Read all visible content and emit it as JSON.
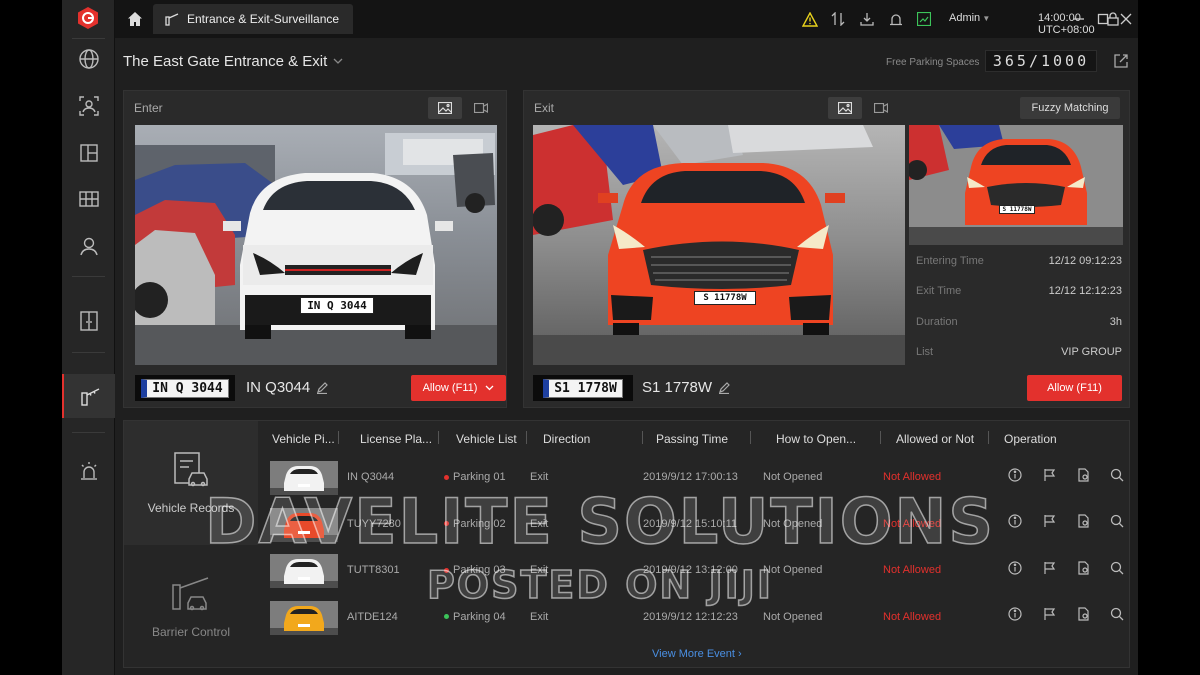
{
  "window": {
    "tab_title": "Entrance & Exit-Surveillance",
    "admin": "Admin",
    "clock": "14:00:00 UTC+08:00"
  },
  "header": {
    "gate_title": "The East Gate Entrance & Exit",
    "free_spaces_label": "Free Parking Spaces",
    "free_spaces_value": "365/1000"
  },
  "enter_panel": {
    "label": "Enter",
    "photo_plate": "IN Q 3044",
    "plate_thumb": "IN Q 3044",
    "plate_text": "IN Q3044",
    "allow_label": "Allow (F11)"
  },
  "exit_panel": {
    "label": "Exit",
    "fuzzy_label": "Fuzzy Matching",
    "photo_plate": "S 11778W",
    "small_plate": "S 11778W",
    "plate_thumb": "S1 1778W",
    "plate_text": "S1 1778W",
    "allow_label": "Allow (F11)",
    "info": [
      {
        "key": "Entering Time",
        "value": "12/12 09:12:23"
      },
      {
        "key": "Exit Time",
        "value": "12/12 12:12:23"
      },
      {
        "key": "Duration",
        "value": "3h"
      },
      {
        "key": "List",
        "value": "VIP GROUP"
      }
    ]
  },
  "records": {
    "side": [
      {
        "label": "Vehicle Records"
      },
      {
        "label": "Barrier Control"
      }
    ],
    "columns": [
      "Vehicle Pi...",
      "License Pla...",
      "Vehicle List",
      "Direction",
      "Passing Time",
      "How to Open...",
      "Allowed or Not",
      "Operation"
    ],
    "rows": [
      {
        "plate": "IN Q3044",
        "list": "Parking 01",
        "list_color": "#e3312d",
        "direction": "Exit",
        "time": "2019/9/12 17:00:13",
        "open": "Not Opened",
        "allowed": "Not Allowed",
        "car_color": "#f2f2f2"
      },
      {
        "plate": "TUYY7280",
        "list": "Parking 02",
        "list_color": "#e3312d",
        "direction": "Exit",
        "time": "2019/9/12 15:10:11",
        "open": "Not Opened",
        "allowed": "Not Allowed",
        "car_color": "#e84a2a"
      },
      {
        "plate": "TUTT8301",
        "list": "Parking 03",
        "list_color": "#e3312d",
        "direction": "Exit",
        "time": "2019/9/12 13:12:00",
        "open": "Not Opened",
        "allowed": "Not Allowed",
        "car_color": "#f2f2f2"
      },
      {
        "plate": "AITDE124",
        "list": "Parking 04",
        "list_color": "#3cc45a",
        "direction": "Exit",
        "time": "2019/9/12 12:12:23",
        "open": "Not Opened",
        "allowed": "Not Allowed",
        "car_color": "#f2a81c"
      }
    ],
    "more_label": "View More Event"
  },
  "watermark": {
    "line1": "DAVELITE SOLUTIONS",
    "line2": "POSTED ON JIJI"
  },
  "colors": {
    "accent": "#e3312d",
    "link": "#4a8fe2"
  }
}
